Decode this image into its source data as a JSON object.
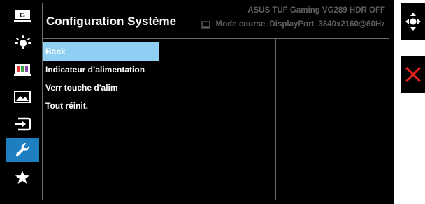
{
  "header": {
    "title": "Configuration Système",
    "model": "ASUS TUF Gaming VG289 HDR OFF",
    "status": {
      "mode": "Mode course",
      "input": "DisplayPort",
      "resolution": "3840x2160@60Hz"
    }
  },
  "sidebar": {
    "items": [
      {
        "icon": "gameplus-icon",
        "label": "G",
        "active": false
      },
      {
        "icon": "splendid-icon",
        "active": false
      },
      {
        "icon": "color-icon",
        "active": false
      },
      {
        "icon": "image-icon",
        "active": false
      },
      {
        "icon": "input-select-icon",
        "active": false
      },
      {
        "icon": "wrench-icon",
        "active": true
      },
      {
        "icon": "star-icon",
        "active": false
      }
    ]
  },
  "menu": {
    "items": [
      {
        "label": "Back",
        "selected": true
      },
      {
        "label": "Indicateur d’alimentation",
        "selected": false
      },
      {
        "label": "Verr touche d'alim",
        "selected": false
      },
      {
        "label": "Tout réinit.",
        "selected": false
      }
    ]
  },
  "nav": {
    "move_icon": "joystick-move-icon",
    "close_icon": "close-icon"
  },
  "colors": {
    "background": "#000000",
    "active_tab": "#1e7fc0",
    "selected_item": "#8ecff3",
    "secondary_text": "#5e5e5e",
    "close": "#e8201e"
  }
}
